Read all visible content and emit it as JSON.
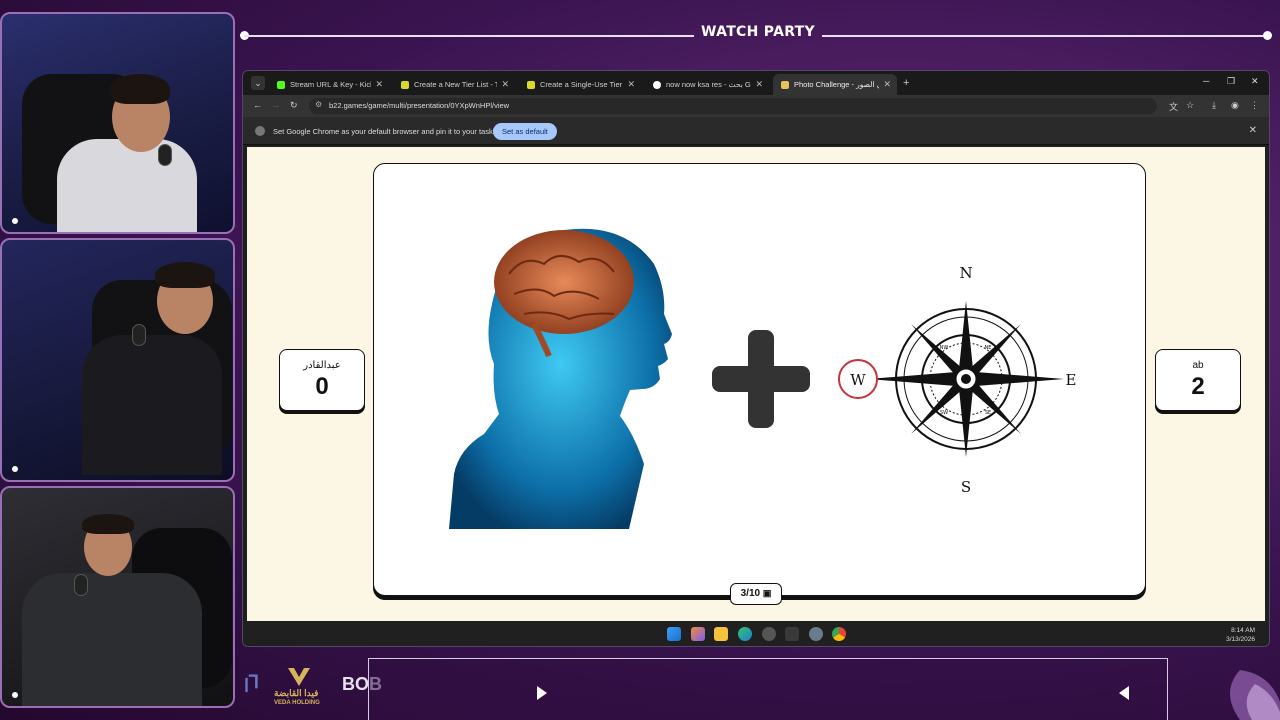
{
  "header": {
    "title": "WATCH PARTY"
  },
  "browser": {
    "tabs": [
      {
        "label": "Stream URL & Key - Kick Dashb",
        "favicon_color": "#53fc18",
        "active": false
      },
      {
        "label": "Create a New Tier List - TierMa",
        "favicon_color": "#d9d92a",
        "active": false
      },
      {
        "label": "Create a Single-Use Tier List (F",
        "favicon_color": "#d9d92a",
        "active": false
      },
      {
        "label": "now now ksa res - بحث Google",
        "favicon_color": "#ffffff",
        "active": false
      },
      {
        "label": "Photo Challenge - تحدي الصور - ",
        "favicon_color": "#e7c15a",
        "active": true
      }
    ],
    "url": "b22.games/game/multi/presentation/0YXpWnHPl/view",
    "infobar": {
      "message": "Set Google Chrome as your default browser and pin it to your taskbar",
      "button_label": "Set as default"
    }
  },
  "game": {
    "left_player": {
      "name": "عبدالقادر",
      "score": "0"
    },
    "right_player": {
      "name": "ab",
      "score": "2"
    },
    "counter": "3/10",
    "compass": {
      "north": "N",
      "east": "E",
      "south": "S",
      "west": "W",
      "ne": "NE",
      "nw": "NW",
      "se": "SE",
      "sw": "SW"
    }
  },
  "taskbar": {
    "time": "8:14 AM",
    "date": "3/13/2026"
  },
  "sponsors": {
    "veda_ar": "فيدا القابضة",
    "veda_en": "VEDA HOLDING",
    "bob": "BOB"
  },
  "colors": {
    "accent": "#a8c7fa",
    "page_bg": "#fcf6e4",
    "frame": "#9a6fb6"
  }
}
